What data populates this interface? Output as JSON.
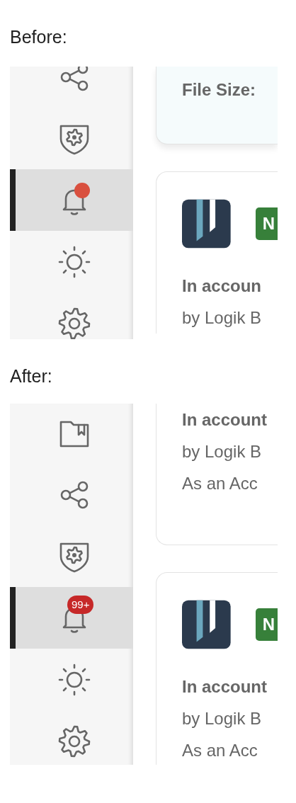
{
  "sections": [
    {
      "label": "Before:",
      "sidebar": [
        {
          "kind": "share",
          "selected": false
        },
        {
          "kind": "shield",
          "selected": false
        },
        {
          "kind": "bell",
          "selected": true,
          "badge": {
            "kind": "dot"
          }
        },
        {
          "kind": "sun",
          "selected": false
        },
        {
          "kind": "gear",
          "selected": false
        }
      ],
      "cards": [
        {
          "kind": "info",
          "lines": [
            {
              "text": "File Size:",
              "bold": true
            }
          ]
        },
        {
          "kind": "item",
          "tag": "N",
          "lines": [
            {
              "text": "In accoun",
              "bold": true
            },
            {
              "text": "by Logik B",
              "bold": false
            }
          ]
        }
      ]
    },
    {
      "label": "After:",
      "sidebar": [
        {
          "kind": "folder",
          "selected": false
        },
        {
          "kind": "share",
          "selected": false
        },
        {
          "kind": "shield",
          "selected": false
        },
        {
          "kind": "bell",
          "selected": true,
          "badge": {
            "kind": "count",
            "text": "99+"
          }
        },
        {
          "kind": "sun",
          "selected": false
        },
        {
          "kind": "gear",
          "selected": false
        }
      ],
      "cards": [
        {
          "kind": "text",
          "lines": [
            {
              "text": "In account",
              "bold": true
            },
            {
              "text": "by Logik B",
              "bold": false
            },
            {
              "text": "As an Acc",
              "bold": false
            }
          ]
        },
        {
          "kind": "item",
          "tag": "N",
          "lines": [
            {
              "text": "In account",
              "bold": true
            },
            {
              "text": "by Logik B",
              "bold": false
            },
            {
              "text": "As an Acc",
              "bold": false
            }
          ]
        }
      ]
    }
  ]
}
